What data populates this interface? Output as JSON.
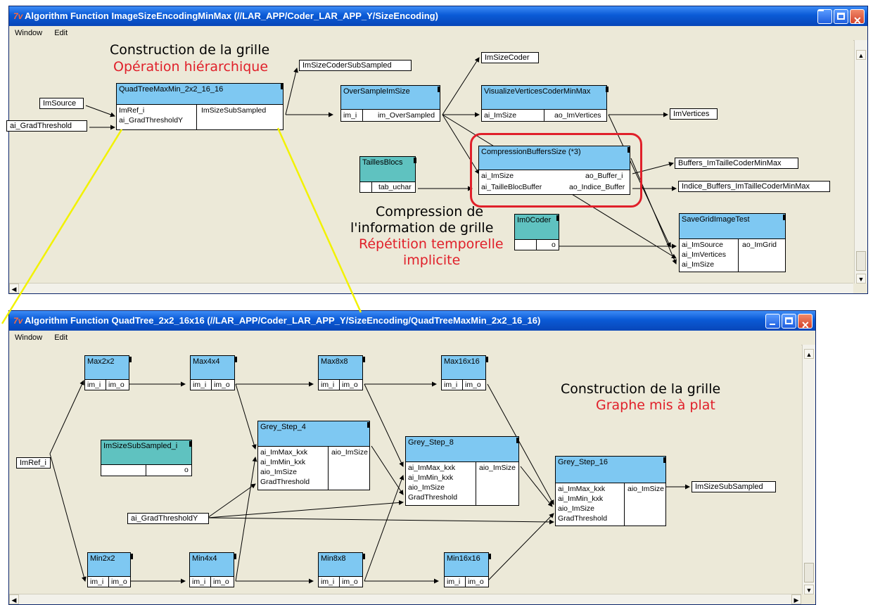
{
  "top_window": {
    "title": "Algorithm Function ImageSizeEncodingMinMax (//LAR_APP/Coder_LAR_APP_Y/SizeEncoding)",
    "menu": [
      "Window",
      "Edit"
    ],
    "annotations": {
      "grid_build": "Construction de la grille",
      "hierarchical": "Opération hiérarchique",
      "compression1": "Compression de",
      "compression2": "l'information de grille",
      "repetition1": "Répétition temporelle",
      "repetition2": "implicite"
    },
    "inputs": {
      "im_source": "ImSource",
      "grad_threshold": "ai_GradThreshold"
    },
    "outputs": {
      "imsize_coder_subsampled": "ImSizeCoderSubSampled",
      "imsize_coder": "ImSizeCoder",
      "im_vertices": "ImVertices",
      "buffers": "Buffers_ImTailleCoderMinMax",
      "indice_buffers": "Indice_Buffers_ImTailleCoderMinMax"
    },
    "quadtree": {
      "title": "QuadTreeMaxMin_2x2_16_16",
      "in1": "ImRef_i",
      "in2": "ai_GradThresholdY",
      "out1": "ImSizeSubSampled"
    },
    "oversample": {
      "title": "OverSampleImSize",
      "in1": "im_i",
      "out1": "im_OverSampled"
    },
    "visualize": {
      "title": "VisualizeVerticesCoderMinMax",
      "in1": "ai_ImSize",
      "out1": "ao_ImVertices"
    },
    "compression": {
      "title": "CompressionBuffersSize (*3)",
      "in1": "ai_ImSize",
      "in2": "ai_TailleBlocBuffer",
      "out1": "ao_Buffer_i",
      "out2": "ao_Indice_Buffer"
    },
    "tailles": {
      "title": "TaillesBlocs",
      "out1": "tab_uchar"
    },
    "im0coder": {
      "title": "Im0Coder",
      "out1": "o"
    },
    "savegrid": {
      "title": "SaveGridImageTest",
      "in1": "ai_ImSource",
      "in2": "ai_ImVertices",
      "in3": "ai_ImSize",
      "out1": "ao_ImGrid"
    }
  },
  "bottom_window": {
    "title": "Algorithm Function QuadTree_2x2_16x16 (//LAR_APP/Coder_LAR_APP_Y/SizeEncoding/QuadTreeMaxMin_2x2_16_16)",
    "menu": [
      "Window",
      "Edit"
    ],
    "annotations": {
      "grid_build": "Construction de la grille",
      "flattened": "Graphe mis à plat"
    },
    "inputs": {
      "imref": "ImRef_i",
      "grad": "ai_GradThresholdY"
    },
    "output": "ImSizeSubSampled",
    "port_in": "im_i",
    "port_out": "im_o",
    "max_nodes": [
      "Max2x2",
      "Max4x4",
      "Max8x8",
      "Max16x16"
    ],
    "min_nodes": [
      "Min2x2",
      "Min4x4",
      "Min8x8",
      "Min16x16"
    ],
    "imsizesub": {
      "title": "ImSizeSubSampled_i",
      "out1": "o"
    },
    "grey4": {
      "title": "Grey_Step_4"
    },
    "grey8": {
      "title": "Grey_Step_8"
    },
    "grey16": {
      "title": "Grey_Step_16"
    },
    "grey_ports": {
      "in1": "ai_ImMax_kxk",
      "in2": "ai_ImMin_kxk",
      "in3": "aio_ImSize",
      "in4": "GradThreshold",
      "out1": "aio_ImSize"
    }
  },
  "colors": {
    "node_header": "#7ec8f2",
    "teal_header": "#5fc2c0",
    "annotation_red": "#e0202a",
    "highlight": "#e0202a",
    "connector": "#f2f200"
  }
}
